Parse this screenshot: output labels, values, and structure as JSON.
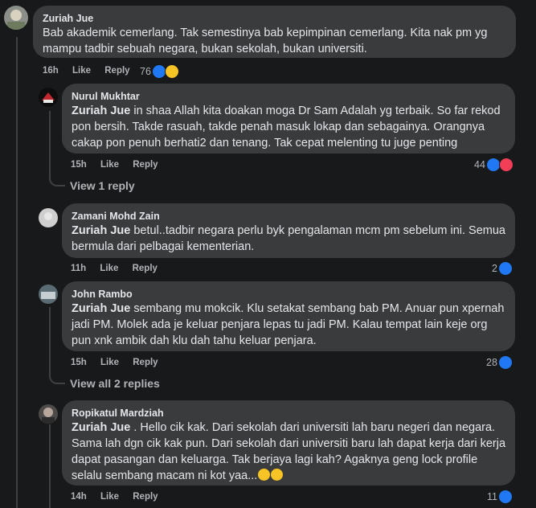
{
  "comments": [
    {
      "author": "Zuriah Jue",
      "text": "Bab akademik cemerlang. Tak semestinya bab kepimpinan cemerlang. Kita nak pm yg mampu tadbir sebuah negara, bukan sekolah, bukan universiti.",
      "time": "16h",
      "like": "Like",
      "reply": "Reply",
      "reactions": "76",
      "reaction_icons": [
        "like-icon",
        "haha-icon"
      ]
    },
    {
      "author": "Nurul Mukhtar",
      "mention": "Zuriah Jue",
      "text": " in shaa Allah kita doakan moga Dr Sam Adalah yg terbaik. So far rekod pon bersih. Takde rasuah, takde penah masuk lokap dan sebagainya. Orangnya cakap pon penuh berhati2 dan tenang. Tak cepat melenting tu juge penting",
      "time": "15h",
      "like": "Like",
      "reply": "Reply",
      "reactions": "44",
      "reaction_icons": [
        "like-icon",
        "love-icon"
      ],
      "view_replies": "View 1 reply"
    },
    {
      "author": "Zamani Mohd Zain",
      "mention": "Zuriah Jue",
      "text": " betul..tadbir negara perlu byk pengalaman mcm pm sebelum ini. Semua bermula dari pelbagai kementerian.",
      "time": "11h",
      "like": "Like",
      "reply": "Reply",
      "reactions": "2",
      "reaction_icons": [
        "like-icon"
      ]
    },
    {
      "author": "John Rambo",
      "mention": "Zuriah Jue",
      "text": " sembang mu mokcik. Klu setakat sembang bab PM. Anuar pun xpernah jadi PM. Molek ada je keluar penjara lepas tu jadi PM. Kalau tempat lain keje org pun xnk ambik dah klu dah tahu keluar penjara.",
      "time": "15h",
      "like": "Like",
      "reply": "Reply",
      "reactions": "28",
      "reaction_icons": [
        "like-icon"
      ],
      "view_replies": "View all 2 replies"
    },
    {
      "author": "Ropikatul Mardziah",
      "mention": "Zuriah Jue",
      "text": " . Hello cik kak. Dari sekolah dari universiti lah baru negeri dan negara. Sama lah dgn cik kak pun. Dari sekolah dari universiti baru lah dapat kerja dari kerja dapat pasangan dan keluarga. Tak berjaya lagi kah? Agaknya geng lock profile selalu sembang macam ni kot yaa...",
      "time": "14h",
      "like": "Like",
      "reply": "Reply",
      "reactions": "11",
      "reaction_icons": [
        "like-icon"
      ]
    }
  ],
  "colors": {
    "background": "#18191a",
    "bubble": "#3a3b3c",
    "like_blue": "#2078f4",
    "love_red": "#f33e58",
    "haha_yellow": "#f7c325"
  }
}
